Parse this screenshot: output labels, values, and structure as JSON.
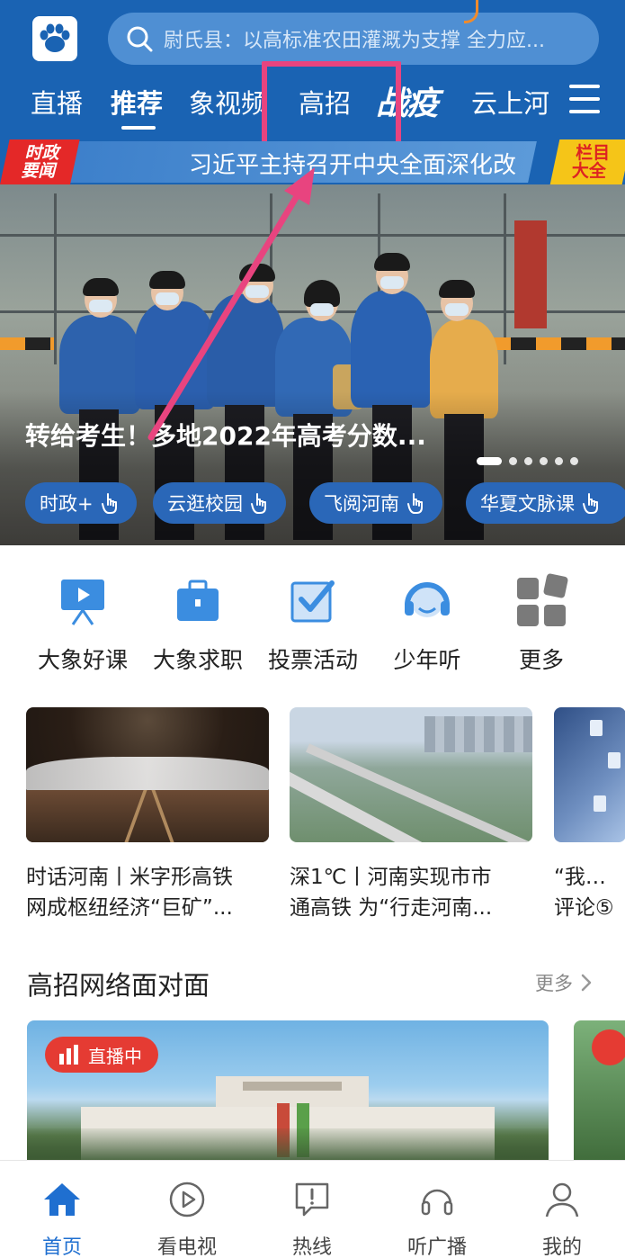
{
  "search": {
    "placeholder": "尉氏县：以高标准农田灌溉为支撑 全力应..."
  },
  "nav": {
    "tabs": [
      {
        "label": "直播"
      },
      {
        "label": "推荐"
      },
      {
        "label": "象视频"
      },
      {
        "label": "高招"
      },
      {
        "label": "战疫"
      },
      {
        "label": "云上河"
      }
    ],
    "active_index": 1
  },
  "ticker": {
    "left_badge_line1": "时政",
    "left_badge_line2": "要闻",
    "text": "习近平主持召开中央全面深化改",
    "right_badge_line1": "栏目",
    "right_badge_line2": "大全"
  },
  "hero": {
    "title": "转给考生！多地2022年高考分数...",
    "chips": [
      {
        "label": "时政+"
      },
      {
        "label": "云逛校园"
      },
      {
        "label": "飞阅河南"
      },
      {
        "label": "华夏文脉课"
      }
    ],
    "slide_count": 6,
    "active_slide": 1
  },
  "quick_links": [
    {
      "label": "大象好课",
      "icon": "video-lesson-icon"
    },
    {
      "label": "大象求职",
      "icon": "briefcase-icon"
    },
    {
      "label": "投票活动",
      "icon": "vote-checkbox-icon"
    },
    {
      "label": "少年听",
      "icon": "headphones-kid-icon"
    },
    {
      "label": "更多",
      "icon": "grid-more-icon"
    }
  ],
  "cards": [
    {
      "line1": "时话河南丨米字形高铁",
      "line2": "网成枢纽经济“巨矿”..."
    },
    {
      "line1": "深1℃丨河南实现市市",
      "line2": "通高铁 为“行走河南..."
    },
    {
      "line1": "“我为郡",
      "line2": "评论⑤"
    }
  ],
  "section": {
    "title": "高招网络面对面",
    "more": "更多"
  },
  "live": {
    "badge": "直播中"
  },
  "bottom_nav": [
    {
      "label": "首页",
      "icon": "home-icon"
    },
    {
      "label": "看电视",
      "icon": "play-circle-icon"
    },
    {
      "label": "热线",
      "icon": "hotline-icon"
    },
    {
      "label": "听广播",
      "icon": "headphones-icon"
    },
    {
      "label": "我的",
      "icon": "user-icon"
    }
  ],
  "bottom_active_index": 0,
  "colors": {
    "header_blue": "#1a63b3",
    "highlight_pink": "#e8447f",
    "live_red": "#e53b33",
    "active_tab_blue": "#1f6fd0"
  }
}
